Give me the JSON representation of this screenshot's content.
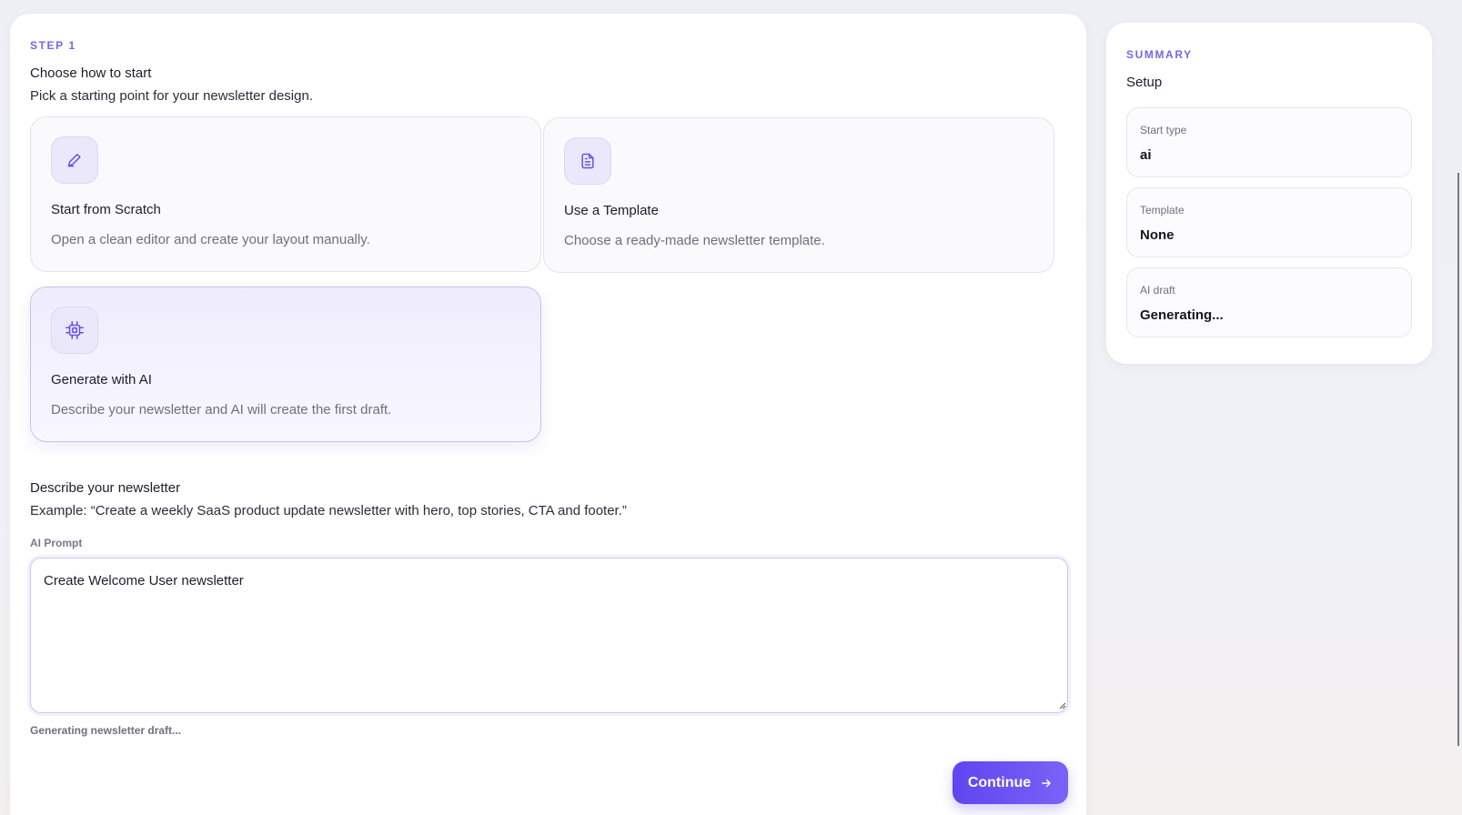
{
  "step": {
    "label": "STEP 1",
    "title": "Choose how to start",
    "subtitle": "Pick a starting point for your newsletter design."
  },
  "options": [
    {
      "title": "Start from Scratch",
      "description": "Open a clean editor and create your layout manually.",
      "icon": "pencil-icon",
      "selected": false
    },
    {
      "title": "Use a Template",
      "description": "Choose a ready-made newsletter template.",
      "icon": "document-icon",
      "selected": false
    },
    {
      "title": "Generate with AI",
      "description": "Describe your newsletter and AI will create the first draft.",
      "icon": "chip-icon",
      "selected": true
    }
  ],
  "describe": {
    "title": "Describe your newsletter",
    "example": "Example: “Create a weekly SaaS product update newsletter with hero, top stories, CTA and footer.”",
    "prompt_label": "AI Prompt",
    "prompt_value": "Create Welcome User newsletter",
    "status": "Generating newsletter draft..."
  },
  "actions": {
    "continue_label": "Continue"
  },
  "summary": {
    "label": "SUMMARY",
    "title": "Setup",
    "items": [
      {
        "key": "Start type",
        "value": "ai"
      },
      {
        "key": "Template",
        "value": "None"
      },
      {
        "key": "AI draft",
        "value": "Generating..."
      }
    ]
  },
  "colors": {
    "accent": "#7766e6",
    "button": "#6a52f3",
    "selected_border": "#c9c1f4"
  }
}
